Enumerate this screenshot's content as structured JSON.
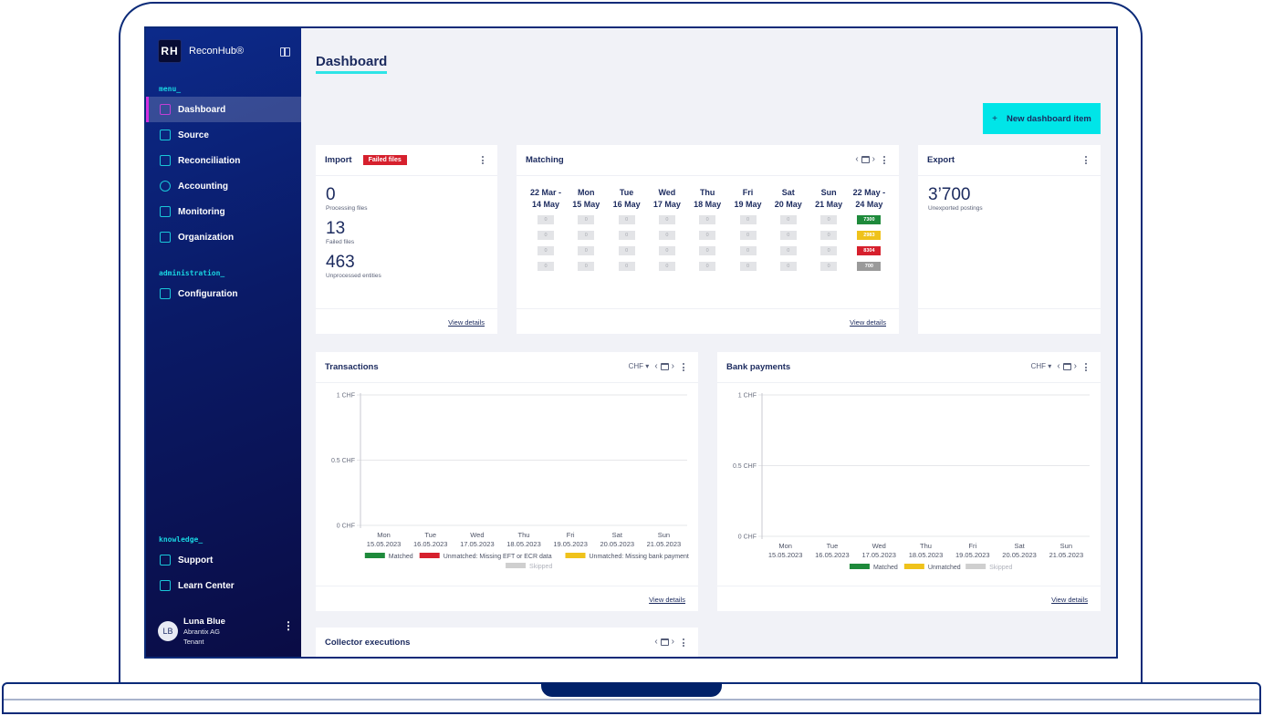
{
  "app": {
    "logo_initials": "RH",
    "logo_name": "ReconHub®"
  },
  "sidebar": {
    "sections": [
      {
        "label": "menu_"
      },
      {
        "label": "administration_"
      },
      {
        "label": "knowledge_"
      }
    ],
    "items": [
      {
        "label": "Dashboard",
        "icon": "dashboard-icon",
        "active": true
      },
      {
        "label": "Source",
        "icon": "source-icon"
      },
      {
        "label": "Reconciliation",
        "icon": "reconciliation-icon"
      },
      {
        "label": "Accounting",
        "icon": "scale-icon"
      },
      {
        "label": "Monitoring",
        "icon": "monitor-icon"
      },
      {
        "label": "Organization",
        "icon": "org-chart-icon"
      },
      {
        "label": "Configuration",
        "icon": "configuration-icon"
      },
      {
        "label": "Support",
        "icon": "chat-icon"
      },
      {
        "label": "Learn Center",
        "icon": "learn-icon"
      }
    ],
    "user": {
      "initials": "LB",
      "name": "Luna Blue",
      "org": "Abrantix AG",
      "role": "Tenant"
    }
  },
  "header": {
    "title": "Dashboard",
    "new_item_label": "New dashboard item",
    "new_item_icon": "+"
  },
  "import_card": {
    "title": "Import",
    "badge": "Failed files",
    "stats": [
      {
        "value": "0",
        "label": "Processing files"
      },
      {
        "value": "13",
        "label": "Failed files"
      },
      {
        "value": "463",
        "label": "Unprocessed entities"
      }
    ],
    "link": "View details"
  },
  "matching_card": {
    "title": "Matching",
    "columns": [
      {
        "line1": "22 Mar -",
        "line2": "14 May",
        "values": [
          "0",
          "0",
          "0",
          "0"
        ]
      },
      {
        "line1": "Mon",
        "line2": "15 May",
        "values": [
          "0",
          "0",
          "0",
          "0"
        ]
      },
      {
        "line1": "Tue",
        "line2": "16 May",
        "values": [
          "0",
          "0",
          "0",
          "0"
        ]
      },
      {
        "line1": "Wed",
        "line2": "17 May",
        "values": [
          "0",
          "0",
          "0",
          "0"
        ]
      },
      {
        "line1": "Thu",
        "line2": "18 May",
        "values": [
          "0",
          "0",
          "0",
          "0"
        ]
      },
      {
        "line1": "Fri",
        "line2": "19 May",
        "values": [
          "0",
          "0",
          "0",
          "0"
        ]
      },
      {
        "line1": "Sat",
        "line2": "20 May",
        "values": [
          "0",
          "0",
          "0",
          "0"
        ]
      },
      {
        "line1": "Sun",
        "line2": "21 May",
        "values": [
          "0",
          "0",
          "0",
          "0"
        ]
      },
      {
        "line1": "22 May -",
        "line2": "24 May",
        "values": [
          "7300",
          "2983",
          "8304",
          "700"
        ]
      }
    ],
    "row_colors": [
      "#1e8a3b",
      "#efc21b",
      "#d6202d",
      "#9a9a9a"
    ],
    "link": "View details"
  },
  "export_card": {
    "title": "Export",
    "value": "3’700",
    "label": "Unexported postings"
  },
  "chart_data": [
    {
      "type": "bar",
      "title": "Transactions",
      "currency": "CHF",
      "categories": [
        "Mon 15.05.2023",
        "Tue 16.05.2023",
        "Wed 17.05.2023",
        "Thu 18.05.2023",
        "Fri 19.05.2023",
        "Sat 20.05.2023",
        "Sun 21.05.2023"
      ],
      "cat_day": [
        "Mon",
        "Tue",
        "Wed",
        "Thu",
        "Fri",
        "Sat",
        "Sun"
      ],
      "cat_date": [
        "15.05.2023",
        "16.05.2023",
        "17.05.2023",
        "18.05.2023",
        "19.05.2023",
        "20.05.2023",
        "21.05.2023"
      ],
      "yticks": [
        "1 CHF",
        "0.5 CHF",
        "0 CHF"
      ],
      "ylim": [
        0,
        1
      ],
      "series": [
        {
          "name": "Matched",
          "color": "#1e8a3b",
          "values": [
            0,
            0,
            0,
            0,
            0,
            0,
            0
          ]
        },
        {
          "name": "Unmatched: Missing EFT or ECR data",
          "color": "#d6202d",
          "values": [
            0,
            0,
            0,
            0,
            0,
            0,
            0
          ]
        },
        {
          "name": "Unmatched: Missing bank payment",
          "color": "#efc21b",
          "values": [
            0,
            0,
            0,
            0,
            0,
            0,
            0
          ]
        },
        {
          "name": "Skipped",
          "color": "#cfcfcf",
          "values": [
            0,
            0,
            0,
            0,
            0,
            0,
            0
          ]
        }
      ],
      "link": "View details"
    },
    {
      "type": "bar",
      "title": "Bank payments",
      "currency": "CHF",
      "categories": [
        "Mon 15.05.2023",
        "Tue 16.05.2023",
        "Wed 17.05.2023",
        "Thu 18.05.2023",
        "Fri 19.05.2023",
        "Sat 20.05.2023",
        "Sun 21.05.2023"
      ],
      "cat_day": [
        "Mon",
        "Tue",
        "Wed",
        "Thu",
        "Fri",
        "Sat",
        "Sun"
      ],
      "cat_date": [
        "15.05.2023",
        "16.05.2023",
        "17.05.2023",
        "18.05.2023",
        "19.05.2023",
        "20.05.2023",
        "21.05.2023"
      ],
      "yticks": [
        "1 CHF",
        "0.5 CHF",
        "0 CHF"
      ],
      "ylim": [
        0,
        1
      ],
      "series": [
        {
          "name": "Matched",
          "color": "#1e8a3b",
          "values": [
            0,
            0,
            0,
            0,
            0,
            0,
            0
          ]
        },
        {
          "name": "Unmatched",
          "color": "#efc21b",
          "values": [
            0,
            0,
            0,
            0,
            0,
            0,
            0
          ]
        },
        {
          "name": "Skipped",
          "color": "#cfcfcf",
          "values": [
            0,
            0,
            0,
            0,
            0,
            0,
            0
          ]
        }
      ],
      "link": "View details"
    }
  ],
  "collector_card": {
    "title": "Collector executions"
  }
}
